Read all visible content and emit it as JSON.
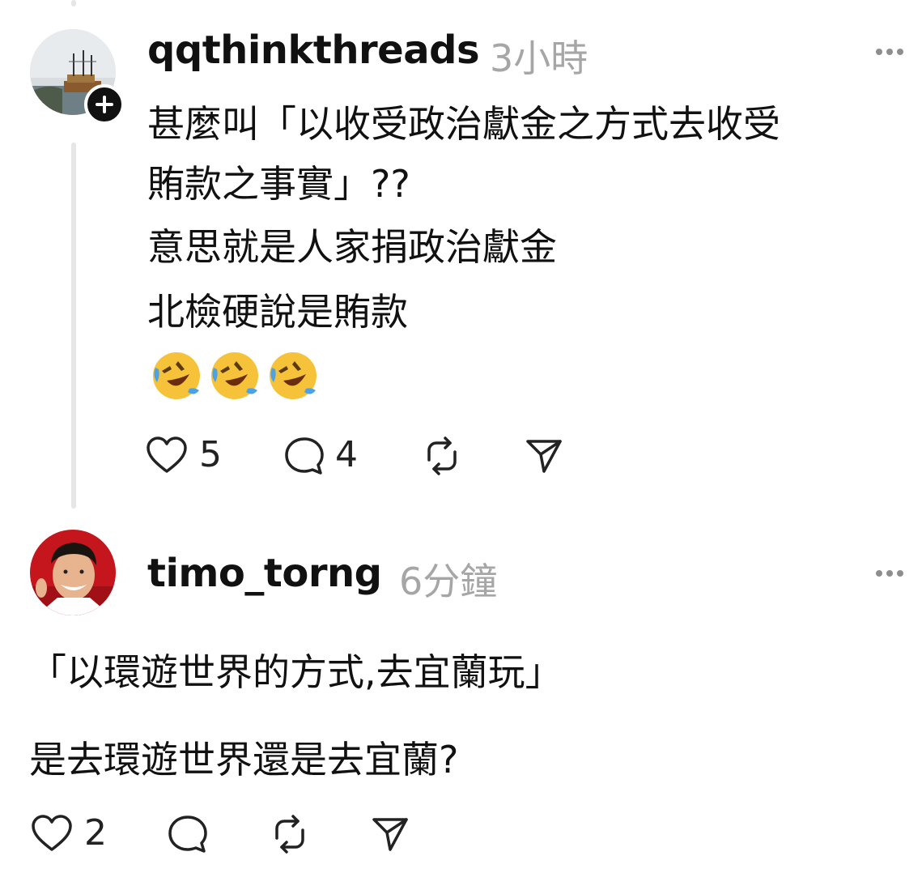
{
  "post1": {
    "username": "qqthinkthreads",
    "time": "3小時",
    "lines": [
      "甚麼叫「以收受政治獻金之方式去收受",
      "賄款之事實」??",
      "意思就是人家捐政治獻金",
      "北檢硬說是賄款"
    ],
    "emojis": [
      "rolling-on-floor-laughing",
      "rolling-on-floor-laughing",
      "rolling-on-floor-laughing"
    ],
    "likes": "5",
    "comments": "4"
  },
  "post2": {
    "username": "timo_torng",
    "time": "6分鐘",
    "lines": [
      "「以環遊世界的方式,去宜蘭玩」",
      "是去環遊世界還是去宜蘭?"
    ],
    "likes": "2"
  },
  "icons": [
    "heart-icon",
    "comment-icon",
    "repost-icon",
    "share-icon",
    "more-icon",
    "follow-plus-icon"
  ],
  "colors": {
    "text": "#111111",
    "muted": "#a6a6a6",
    "thread_line": "#e6e6e6"
  }
}
